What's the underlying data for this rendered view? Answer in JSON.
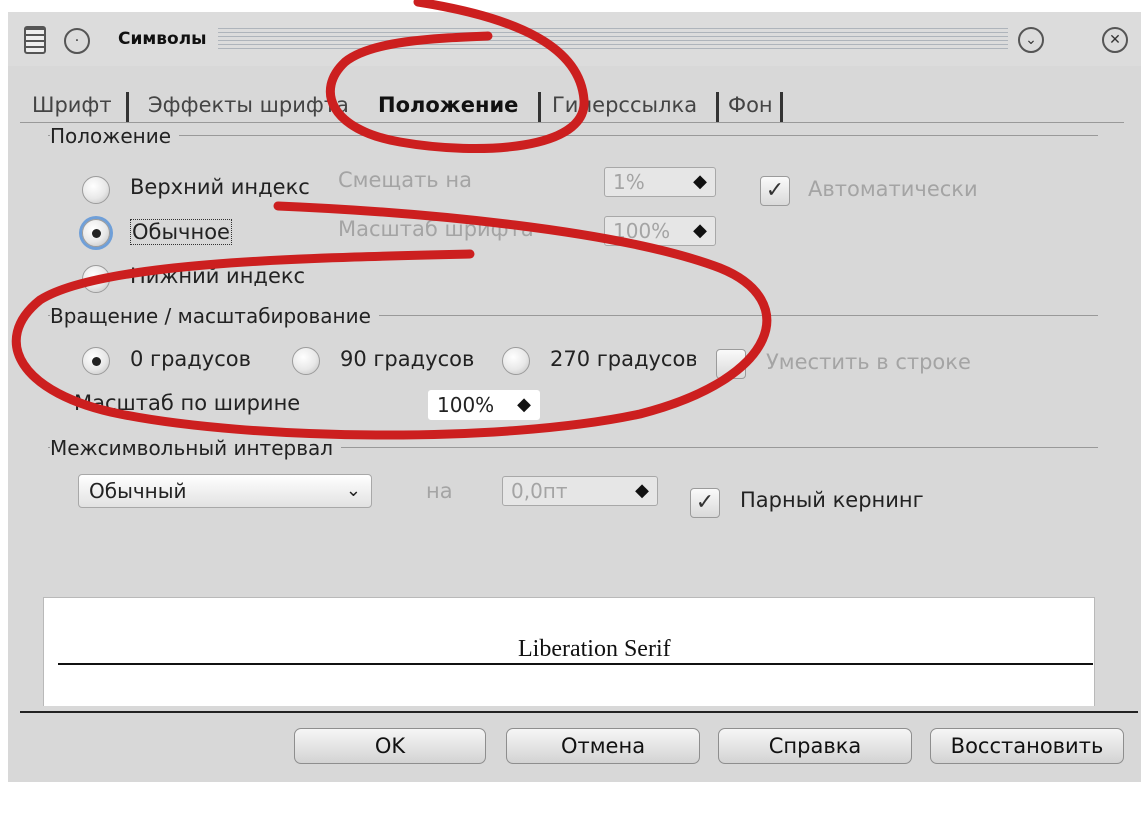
{
  "window": {
    "title": "Символы"
  },
  "tabs": [
    {
      "label": "Шрифт"
    },
    {
      "label": "Эффекты шрифта"
    },
    {
      "label": "Положение",
      "active": true
    },
    {
      "label": "Гиперссылка"
    },
    {
      "label": "Фон"
    }
  ],
  "position": {
    "group_title": "Положение",
    "superscript": "Верхний индекс",
    "normal": "Обычное",
    "subscript": "Нижний индекс",
    "selected": "Обычное",
    "raise_label": "Смещать на",
    "raise_value": "1%",
    "font_size_label": "Масштаб шрифта",
    "font_size_value": "100%",
    "auto_label": "Автоматически"
  },
  "rotation": {
    "group_title": "Вращение / масштабирование",
    "deg0": "0 градусов",
    "deg90": "90 градусов",
    "deg270": "270 градусов",
    "fit_label": "Уместить в строке",
    "scale_width_label": "Масштаб по ширине",
    "scale_width_value": "100%"
  },
  "spacing": {
    "group_title": "Межсимвольный интервал",
    "mode": "Обычный",
    "by_label": "на",
    "by_value": "0,0пт",
    "kerning_label": "Парный кернинг"
  },
  "preview": {
    "text": "Liberation Serif"
  },
  "buttons": {
    "ok": "OK",
    "cancel": "Отмена",
    "help": "Справка",
    "reset": "Восстановить"
  },
  "colors": {
    "annotation": "#cc1f1f",
    "focus": "#6f9fd8"
  }
}
